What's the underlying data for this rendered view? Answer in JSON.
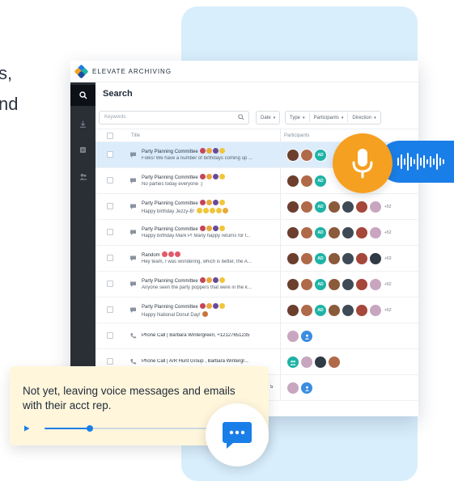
{
  "background": {
    "line1": "s,",
    "line2": "nd"
  },
  "app": {
    "brand": "ELEVATE ARCHIVING",
    "page_title": "Search",
    "toolbar": {
      "keywords_placeholder": "Keywords",
      "date_label": "Date",
      "type_label": "Type",
      "participants_label": "Participants",
      "direction_label": "Direction"
    },
    "table": {
      "col_title": "Title",
      "col_participants": "Participants",
      "rows": [
        {
          "kind": "chat",
          "title": "Party Planning Committee",
          "preview": "Folks! We have a number of birthdays coming up ...",
          "more": "",
          "selected": true
        },
        {
          "kind": "chat",
          "title": "Party Planning Committee",
          "preview": "No parties today everyone :)",
          "more": ""
        },
        {
          "kind": "chat",
          "title": "Party Planning Committee",
          "preview": "Happy birthday Jezzy-B!",
          "more": "+52"
        },
        {
          "kind": "chat",
          "title": "Party Planning Committee",
          "preview": "Happy birthday Mark P! Many happy returns for t...",
          "more": "+52"
        },
        {
          "kind": "chat",
          "title": "Random",
          "preview": "Hey team, I was wondering, which is better, the A...",
          "more": "+63"
        },
        {
          "kind": "chat",
          "title": "Party Planning Committee",
          "preview": "Anyone seen the party poppers that were in the k...",
          "more": "+52"
        },
        {
          "kind": "chat",
          "title": "Party Planning Committee",
          "preview": "Happy National Donut Day!",
          "more": "+52"
        },
        {
          "kind": "phone",
          "title": "Phone Call | Barbara Wintergreen, +12127651235"
        },
        {
          "kind": "phone",
          "title": "Phone Call | A/R Hunt Group , Barbara Wintergr..."
        },
        {
          "kind": "other",
          "title": "5"
        }
      ]
    }
  },
  "avatar_badge": "AD",
  "voice_message": {
    "text": "Not yet, leaving voice messages and emails with their acct rep.",
    "progress": 0.28
  },
  "colors": {
    "accent_blue": "#1a7ee8",
    "mic_orange": "#f5a020",
    "panel_blue": "#d8eefc",
    "card_yellow": "#fff6dc",
    "teal_badge": "#1fb3a6"
  },
  "icons": {
    "mic": "microphone-icon",
    "wave": "soundwave-icon",
    "chat": "chat-bubble-icon",
    "play": "play-icon"
  }
}
